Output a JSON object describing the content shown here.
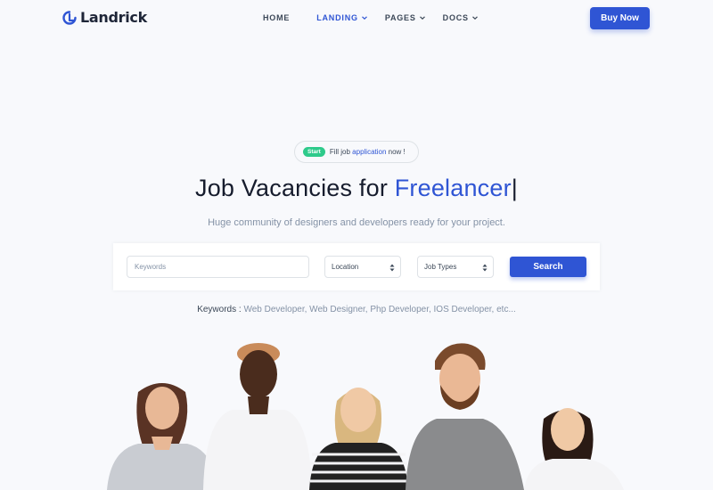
{
  "brand": {
    "name": "Landrick"
  },
  "nav": {
    "items": [
      {
        "label": "HOME",
        "dropdown": false,
        "active": false
      },
      {
        "label": "LANDING",
        "dropdown": true,
        "active": true
      },
      {
        "label": "PAGES",
        "dropdown": true,
        "active": false
      },
      {
        "label": "DOCS",
        "dropdown": true,
        "active": false
      }
    ],
    "buy_label": "Buy Now"
  },
  "hero": {
    "badge": "Start",
    "pill_prefix": "Fill job",
    "pill_highlight": "application",
    "pill_suffix": "now !",
    "title_prefix": "Job Vacancies for",
    "title_highlight": "Freelancer",
    "title_cursor": "|",
    "subtitle": "Huge community of designers and developers ready for your project."
  },
  "search": {
    "keywords_placeholder": "Keywords",
    "location_value": "Location",
    "job_types_value": "Job Types",
    "button_label": "Search"
  },
  "keywords": {
    "label": "Keywords :",
    "list": "Web Developer, Web Designer, Php Developer, IOS Developer, etc..."
  },
  "colors": {
    "primary": "#2f55d4",
    "success": "#2eca8b",
    "muted": "#8492a6",
    "dark": "#161c2d",
    "background": "#f8f9fc"
  },
  "icons": [
    "logo-mark-icon",
    "chevron-down-icon",
    "select-arrows-icon"
  ]
}
